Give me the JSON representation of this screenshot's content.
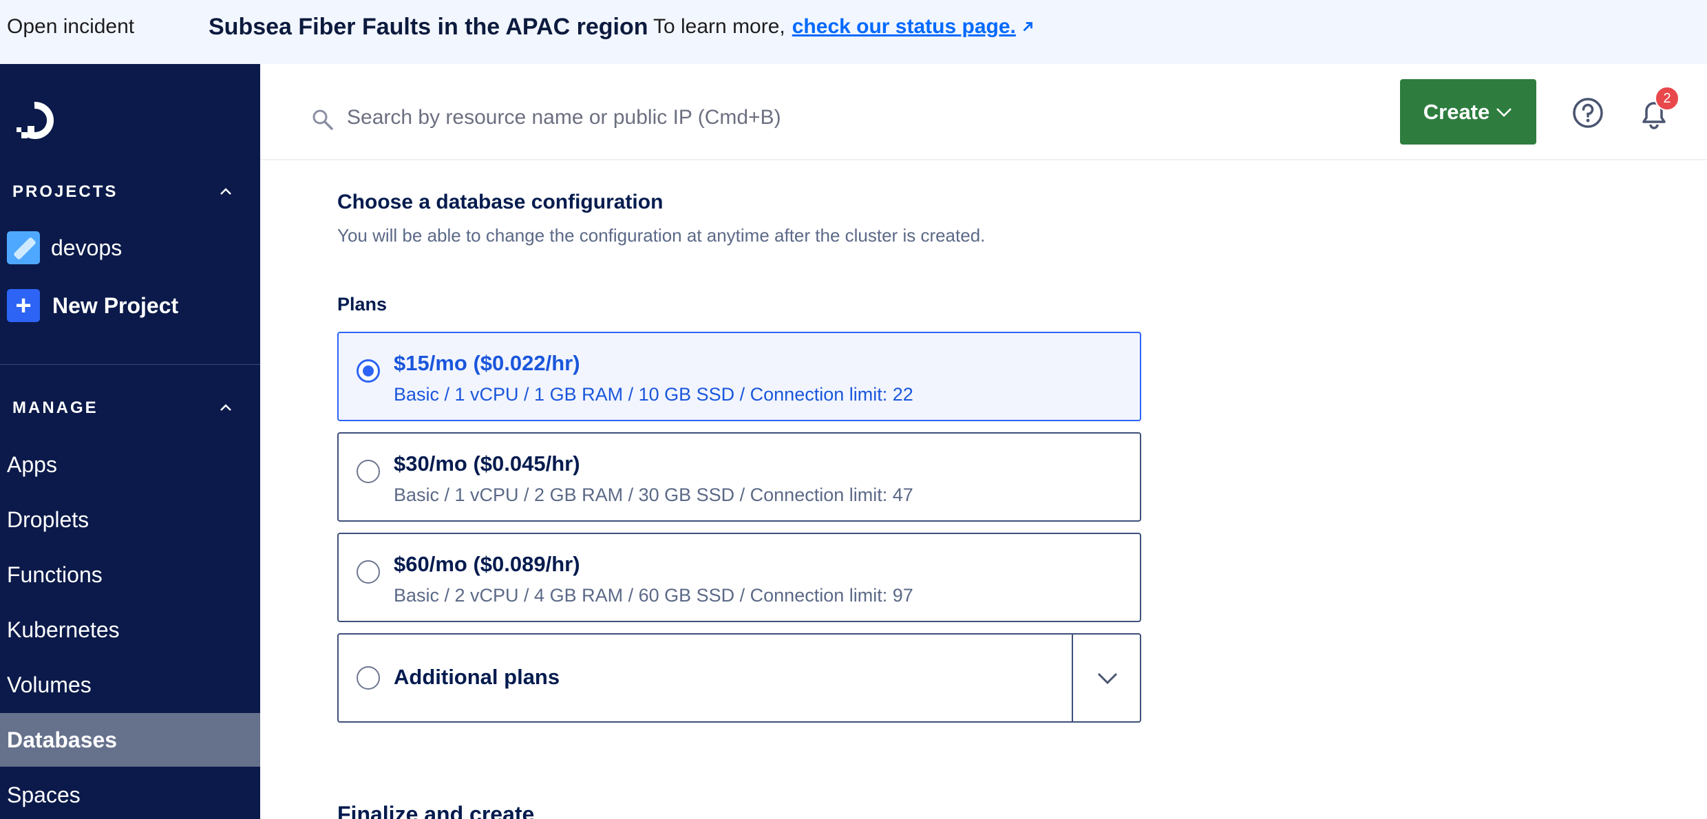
{
  "banner": {
    "status": "Open incident",
    "title": "Subsea Fiber Faults in the APAC region",
    "message": "To learn more,",
    "link_text": "check our status page."
  },
  "sidebar": {
    "projects_heading": "PROJECTS",
    "projects": [
      {
        "label": "devops"
      },
      {
        "label": "New Project"
      }
    ],
    "manage_heading": "MANAGE",
    "nav_items": [
      {
        "label": "Apps"
      },
      {
        "label": "Droplets"
      },
      {
        "label": "Functions"
      },
      {
        "label": "Kubernetes"
      },
      {
        "label": "Volumes"
      },
      {
        "label": "Databases",
        "active": true
      },
      {
        "label": "Spaces"
      }
    ]
  },
  "header": {
    "search_placeholder": "Search by resource name or public IP (Cmd+B)",
    "create_label": "Create",
    "notification_count": "2"
  },
  "main": {
    "config_title": "Choose a database configuration",
    "config_subtitle": "You will be able to change the configuration at anytime after the cluster is created.",
    "plans_label": "Plans",
    "plans": [
      {
        "price": "$15/mo ($0.022/hr)",
        "spec": "Basic / 1 vCPU / 1 GB RAM / 10 GB SSD / Connection limit: 22",
        "selected": true
      },
      {
        "price": "$30/mo ($0.045/hr)",
        "spec": "Basic / 1 vCPU / 2 GB RAM / 30 GB SSD / Connection limit: 47",
        "selected": false
      },
      {
        "price": "$60/mo ($0.089/hr)",
        "spec": "Basic / 2 vCPU / 4 GB RAM / 60 GB SSD / Connection limit: 97",
        "selected": false
      }
    ],
    "additional_plans_label": "Additional plans",
    "finalize_heading": "Finalize and create"
  },
  "colors": {
    "sidebar_bg": "#0b1a4a",
    "accent_blue": "#2d64f5",
    "create_green": "#2e7d3f",
    "badge_red": "#e8474b",
    "banner_bg": "#f2f6fe"
  },
  "icons": [
    "do-logo-icon",
    "chevron-up-icon",
    "plus-icon",
    "search-icon",
    "chevron-down-icon",
    "help-circle-icon",
    "bell-icon",
    "external-arrow-icon"
  ]
}
